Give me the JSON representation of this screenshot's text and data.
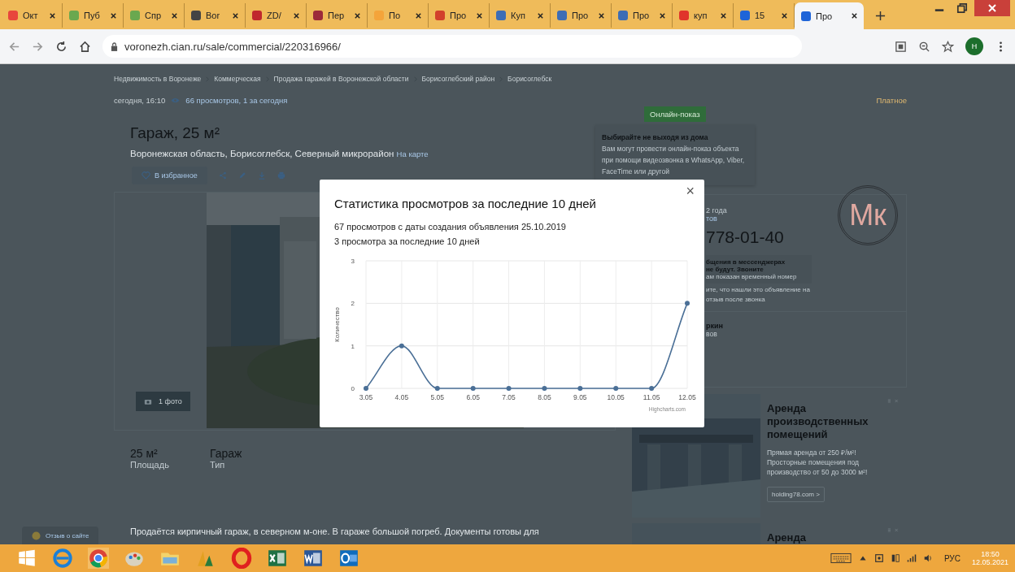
{
  "browser": {
    "tabs": [
      {
        "title": "Окт",
        "selected": false,
        "color": "#e8453c"
      },
      {
        "title": "Пуб",
        "selected": false,
        "color": "#6aa84f"
      },
      {
        "title": "Спр",
        "selected": false,
        "color": "#6aa84f"
      },
      {
        "title": "Bor",
        "selected": false,
        "color": "#444444"
      },
      {
        "title": "ZD/",
        "selected": false,
        "color": "#c0282d"
      },
      {
        "title": "Пер",
        "selected": false,
        "color": "#9c2a3a"
      },
      {
        "title": "По",
        "selected": false,
        "color": "#f4a43a"
      },
      {
        "title": "Про",
        "selected": false,
        "color": "#d2402c"
      },
      {
        "title": "Куп",
        "selected": false,
        "color": "#3d6db5"
      },
      {
        "title": "Про",
        "selected": false,
        "color": "#3d6db5"
      },
      {
        "title": "Про",
        "selected": false,
        "color": "#3d6db5"
      },
      {
        "title": "куп",
        "selected": false,
        "color": "#e0342b"
      },
      {
        "title": "15",
        "selected": false,
        "color": "#1e64d8"
      },
      {
        "title": "Про",
        "selected": true,
        "color": "#1e64d8"
      }
    ],
    "url": "voronezh.cian.ru/sale/commercial/220316966/",
    "profile": "Н"
  },
  "page": {
    "breadcrumbs": [
      "Недвижимость в Воронеже",
      "Коммерческая",
      "Продажа гаражей в Воронежской области",
      "Борисоглебский район",
      "Борисоглебск"
    ],
    "date": "сегодня, 16:10",
    "views": "66 просмотров, 1 за сегодня",
    "paid": "Платное",
    "title": "Гараж, 25 м²",
    "address": "Воронежская область, Борисоглебск, Северный микрорайон",
    "map_link": "На карте",
    "favorite": "В избранное",
    "photo_count": "1 фото",
    "params": [
      {
        "value": "25 м²",
        "label": "Площадь"
      },
      {
        "value": "Гараж",
        "label": "Тип"
      }
    ],
    "description": "Продаётся кирпичный гараж, в северном м-оне. В гараже большой погреб. Документы готовы для",
    "feedback": "Отзыв о сайте",
    "online": {
      "badge": "Онлайн-показ",
      "heading": "Выбирайте не выходя из дома",
      "text": "Вам могут провести онлайн-показ объекта при помощи видеозвонка в WhatsApp, Viber, FaceTime или другой"
    },
    "agent": {
      "logo": "Мк",
      "since": "2 года",
      "objects": "тов",
      "phone": "778-01-40",
      "warning_1": "бщения в мессенджерах",
      "warning_2": "не будут. Звоните",
      "warning_3": "ам показан временный номер",
      "hint_1": "ите, что нашли это объявление на",
      "hint_2": "отзыв после звонка",
      "name": "ркин",
      "role": "вов"
    },
    "ads": [
      {
        "title": "Аренда производственных помещений",
        "text": "Прямая аренда от 250 ₽/м²! Просторные помещения под производство от 50 до 3000 м²!",
        "link": "holding78.com >"
      },
      {
        "title": "Аренда"
      }
    ]
  },
  "modal": {
    "title": "Статистика просмотров за последние 10 дней",
    "line_1": "67 просмотров с даты создания объявления 25.10.2019",
    "line_2": "3 просмотра за последние 10 дней",
    "close": "×",
    "chart_data": {
      "type": "line",
      "ylabel": "Количество",
      "categories": [
        "3.05",
        "4.05",
        "5.05",
        "6.05",
        "7.05",
        "8.05",
        "9.05",
        "10.05",
        "11.05",
        "12.05"
      ],
      "series": [
        {
          "color": "#4a6f96",
          "marker": true,
          "values": [
            0,
            1,
            0,
            0,
            0,
            0,
            0,
            0,
            0,
            2
          ]
        }
      ],
      "ylim": [
        0,
        3
      ],
      "yticks": [
        0,
        1,
        2,
        3
      ],
      "grid": true
    },
    "chart_credits": "Highcharts.com"
  },
  "taskbar": {
    "language": "РУС",
    "time": "18:50",
    "date": "12.05.2021"
  }
}
